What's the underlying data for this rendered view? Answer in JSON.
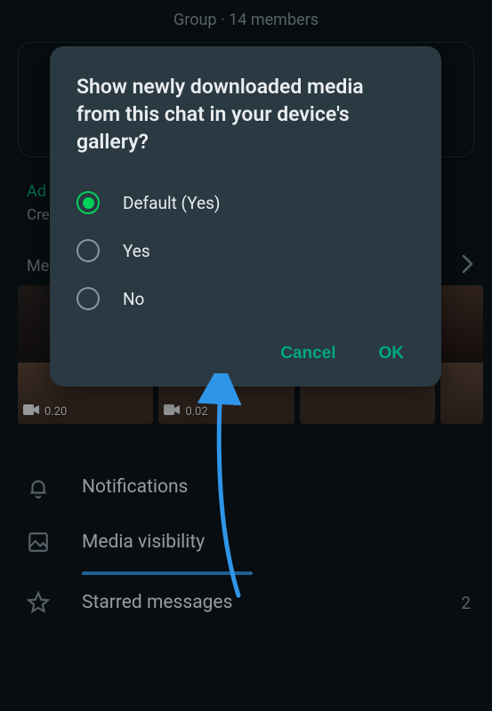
{
  "header": {
    "subtitle": "Group · 14 members"
  },
  "info": {
    "add_description_label": "Ad",
    "created_prefix": "Cre"
  },
  "media": {
    "section_label_truncated": "Me",
    "thumb1_duration": "0.20",
    "thumb2_duration": "0.02"
  },
  "list": {
    "notifications": "Notifications",
    "media_visibility": "Media visibility",
    "starred_messages": "Starred messages",
    "starred_count": "2"
  },
  "dialog": {
    "title": "Show newly downloaded media from this chat in your device's gallery?",
    "options": {
      "default": "Default (Yes)",
      "yes": "Yes",
      "no": "No"
    },
    "cancel": "Cancel",
    "ok": "OK"
  }
}
